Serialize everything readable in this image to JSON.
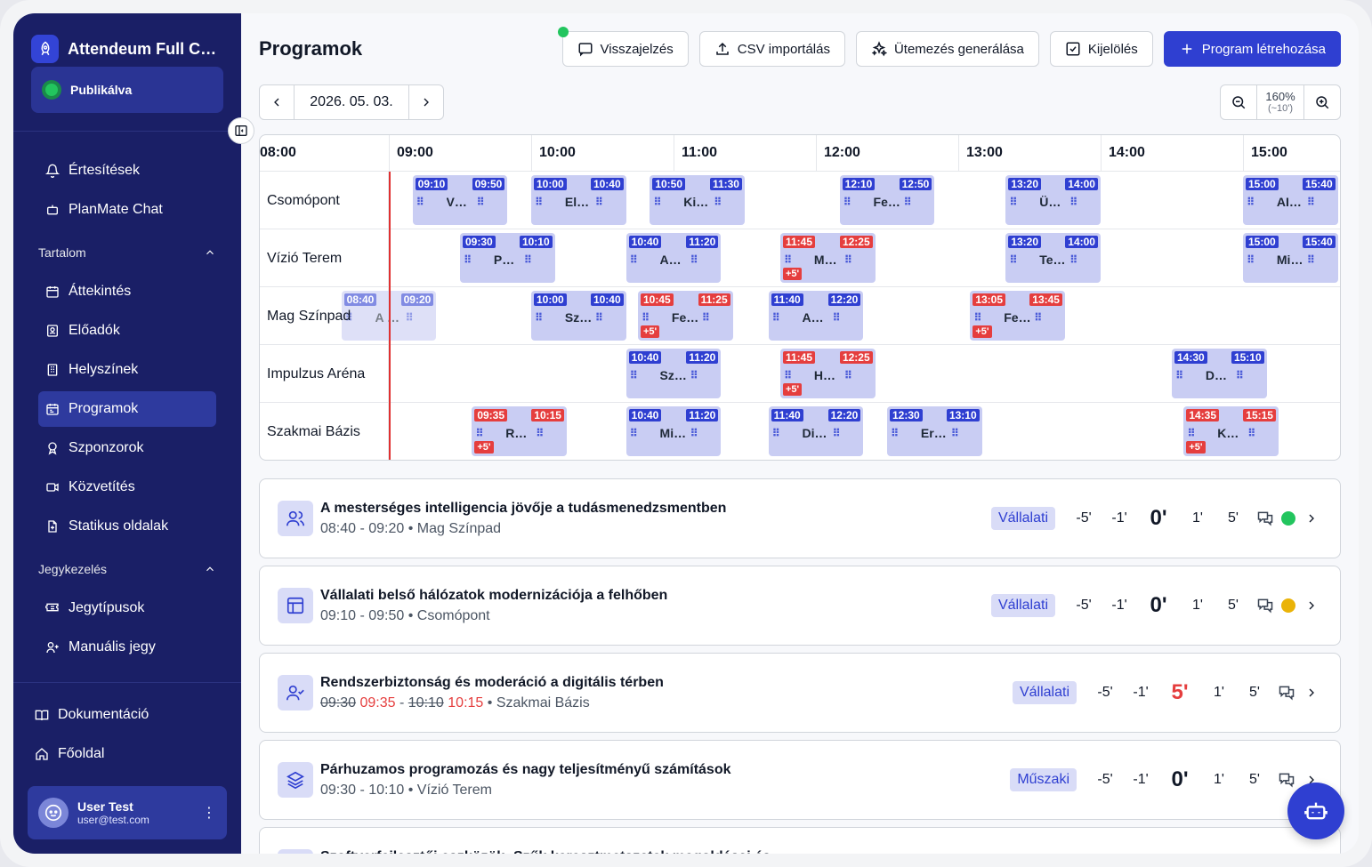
{
  "app": {
    "title": "Attendeum Full Co...",
    "status": "Publikálva"
  },
  "nav": {
    "top": [
      {
        "label": "Értesítések",
        "icon": "bell-icon"
      },
      {
        "label": "PlanMate Chat",
        "icon": "robot-icon"
      }
    ],
    "content_section": "Tartalom",
    "content": [
      {
        "label": "Áttekintés",
        "icon": "calendar-icon"
      },
      {
        "label": "Előadók",
        "icon": "badge-icon"
      },
      {
        "label": "Helyszínek",
        "icon": "building-icon"
      },
      {
        "label": "Programok",
        "icon": "schedule-icon",
        "active": true
      },
      {
        "label": "Szponzorok",
        "icon": "award-icon"
      },
      {
        "label": "Közvetítés",
        "icon": "video-icon"
      },
      {
        "label": "Statikus oldalak",
        "icon": "file-icon"
      }
    ],
    "ticket_section": "Jegykezelés",
    "tickets": [
      {
        "label": "Jegytípusok",
        "icon": "ticket-icon"
      },
      {
        "label": "Manuális jegy",
        "icon": "user-plus-icon"
      }
    ],
    "bottom": [
      {
        "label": "Dokumentáció",
        "icon": "book-icon"
      },
      {
        "label": "Főoldal",
        "icon": "home-icon"
      }
    ]
  },
  "user": {
    "name": "User Test",
    "email": "user@test.com"
  },
  "header": {
    "title": "Programok",
    "buttons": {
      "feedback": "Visszajelzés",
      "csv": "CSV importálás",
      "generate": "Ütemezés generálása",
      "select": "Kijelölés",
      "create": "Program létrehozása"
    }
  },
  "date": "2026. 05. 03.",
  "zoom": {
    "level": "160%",
    "step": "(~10')"
  },
  "timeline": {
    "hours": [
      "08:00",
      "09:00",
      "10:00",
      "11:00",
      "12:00",
      "13:00",
      "14:00",
      "15:00"
    ],
    "rooms": [
      "Csomópont",
      "Vízió Terem",
      "Mag Színpad",
      "Impulzus Aréna",
      "Szakmai Bázis"
    ],
    "events": [
      {
        "room": 0,
        "start": "09:10",
        "end": "09:50",
        "title": "Vállalati ...",
        "late": false
      },
      {
        "room": 0,
        "start": "10:00",
        "end": "10:40",
        "title": "Elosztott ...",
        "late": false
      },
      {
        "room": 0,
        "start": "10:50",
        "end": "11:30",
        "title": "Kiberbizt...",
        "late": false
      },
      {
        "room": 0,
        "start": "12:10",
        "end": "12:50",
        "title": "Fenntart...",
        "late": false
      },
      {
        "room": 0,
        "start": "13:20",
        "end": "14:00",
        "title": "Ügyfélhű...",
        "late": false
      },
      {
        "room": 0,
        "start": "15:00",
        "end": "15:40",
        "title": "AI a vezet...",
        "late": false
      },
      {
        "room": 1,
        "start": "09:30",
        "end": "10:10",
        "title": "Párhuza...",
        "late": false
      },
      {
        "room": 1,
        "start": "10:40",
        "end": "11:20",
        "title": "Agilis mó...",
        "late": false
      },
      {
        "room": 1,
        "start": "11:45",
        "end": "12:25",
        "title": "Modern fr...",
        "late": true,
        "delay": "+5'"
      },
      {
        "room": 1,
        "start": "13:20",
        "end": "14:00",
        "title": "Termékfej...",
        "late": false
      },
      {
        "room": 1,
        "start": "15:00",
        "end": "15:40",
        "title": "Migrációs...",
        "late": false
      },
      {
        "room": 2,
        "start": "08:40",
        "end": "09:20",
        "title": "A mester...",
        "late": false,
        "ghost": true
      },
      {
        "room": 2,
        "start": "10:00",
        "end": "10:40",
        "title": "Szoftverf...",
        "late": false
      },
      {
        "room": 2,
        "start": "10:45",
        "end": "11:25",
        "title": "Felhaszn...",
        "late": true,
        "delay": "+5'"
      },
      {
        "room": 2,
        "start": "11:40",
        "end": "12:20",
        "title": "Adattárol...",
        "late": false
      },
      {
        "room": 2,
        "start": "13:05",
        "end": "13:45",
        "title": "Fejlesztői...",
        "late": true,
        "delay": "+5'"
      },
      {
        "room": 3,
        "start": "10:40",
        "end": "11:20",
        "title": "Szoftver...",
        "late": false
      },
      {
        "room": 3,
        "start": "11:45",
        "end": "12:25",
        "title": "Hálózati i...",
        "late": true,
        "delay": "+5'"
      },
      {
        "room": 3,
        "start": "14:30",
        "end": "15:10",
        "title": "Deep Lea...",
        "late": false
      },
      {
        "room": 4,
        "start": "09:35",
        "end": "10:15",
        "title": "Rendszer...",
        "late": true,
        "delay": "+5'"
      },
      {
        "room": 4,
        "start": "10:40",
        "end": "11:20",
        "title": "Middlewa...",
        "late": false
      },
      {
        "room": 4,
        "start": "11:40",
        "end": "12:20",
        "title": "Dizájn-re...",
        "late": false
      },
      {
        "room": 4,
        "start": "12:30",
        "end": "13:10",
        "title": "Erőforrás...",
        "late": false
      },
      {
        "room": 4,
        "start": "14:35",
        "end": "15:15",
        "title": "Konténer...",
        "late": true,
        "delay": "+5'"
      }
    ]
  },
  "programs": [
    {
      "title": "A mesterséges intelligencia jövője a tudásmenedzsmentben",
      "time": "08:40 - 09:20",
      "place": "Mag Színpad",
      "tag": "Vállalati",
      "offset": "0'",
      "status": "#22c55e",
      "icon": "users-icon"
    },
    {
      "title": "Vállalati belső hálózatok modernizációja a felhőben",
      "time": "09:10 - 09:50",
      "place": "Csomópont",
      "tag": "Vállalati",
      "offset": "0'",
      "status": "#eab308",
      "icon": "layout-icon"
    },
    {
      "title": "Rendszerbiztonság és moderáció a digitális térben",
      "old_start": "09:30",
      "new_start": "09:35",
      "old_end": "10:10",
      "new_end": "10:15",
      "place": "Szakmai Bázis",
      "tag": "Vállalati",
      "offset": "5'",
      "icon": "user-check-icon"
    },
    {
      "title": "Párhuzamos programozás és nagy teljesítményű számítások",
      "time": "09:30 - 10:10",
      "place": "Vízió Terem",
      "tag": "Műszaki",
      "offset": "0'",
      "icon": "layers-icon"
    },
    {
      "title": "Szoftverfejlesztői eszközök: Szűk keresztmetszetek megoldásai és ...",
      "time": "",
      "place": "",
      "tag": "",
      "offset": "",
      "icon": "users-icon"
    }
  ],
  "adjust": {
    "m5": "-5'",
    "m1": "-1'",
    "p1": "1'",
    "p5": "5'"
  }
}
